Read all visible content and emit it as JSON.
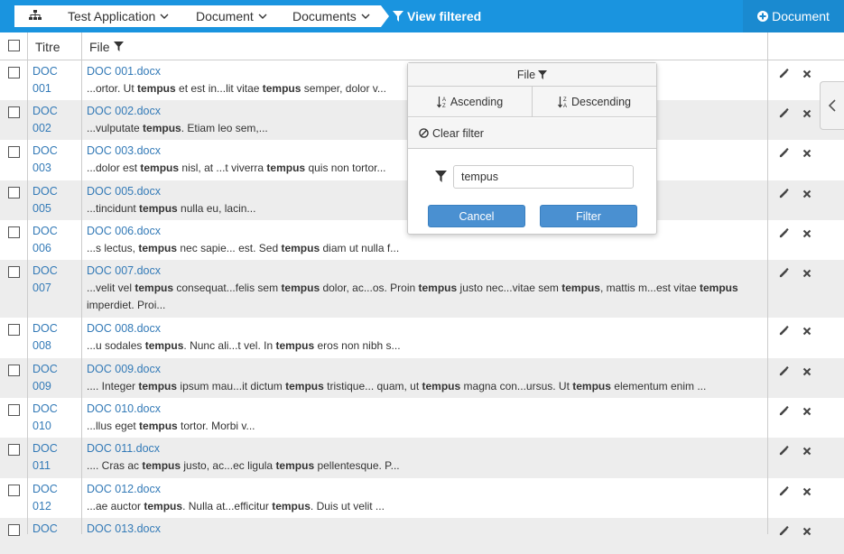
{
  "breadcrumb": {
    "home_icon": "sitemap-icon",
    "items": [
      {
        "label": "Test Application"
      },
      {
        "label": "Document"
      },
      {
        "label": "Documents"
      }
    ],
    "active_label": "View filtered"
  },
  "add_document_label": "Document",
  "table": {
    "col_titre": "Titre",
    "col_file": "File",
    "rows": [
      {
        "titre_a": "DOC",
        "titre_b": "001",
        "file": "DOC 001.docx",
        "snippet": [
          "...ortor. Ut ",
          "tempus",
          " et est in...lit vitae ",
          "tempus",
          " semper, dolor v..."
        ]
      },
      {
        "titre_a": "DOC",
        "titre_b": "002",
        "file": "DOC 002.docx",
        "snippet": [
          "...vulputate ",
          "tempus",
          ". Etiam leo sem,..."
        ]
      },
      {
        "titre_a": "DOC",
        "titre_b": "003",
        "file": "DOC 003.docx",
        "snippet": [
          "...dolor est ",
          "tempus",
          " nisl, at ...t viverra ",
          "tempus",
          " quis non tortor..."
        ]
      },
      {
        "titre_a": "DOC",
        "titre_b": "005",
        "file": "DOC 005.docx",
        "snippet": [
          "...tincidunt ",
          "tempus",
          " nulla eu, lacin..."
        ]
      },
      {
        "titre_a": "DOC",
        "titre_b": "006",
        "file": "DOC 006.docx",
        "snippet": [
          "...s lectus, ",
          "tempus",
          " nec sapie... est. Sed ",
          "tempus",
          " diam ut nulla f..."
        ]
      },
      {
        "titre_a": "DOC",
        "titre_b": "007",
        "file": "DOC 007.docx",
        "snippet": [
          "...velit vel ",
          "tempus",
          " consequat...felis sem ",
          "tempus",
          " dolor, ac...os. Proin ",
          "tempus",
          " justo nec...vitae sem ",
          "tempus",
          ", mattis m...est vitae ",
          "tempus",
          " imperdiet. Proi..."
        ]
      },
      {
        "titre_a": "DOC",
        "titre_b": "008",
        "file": "DOC 008.docx",
        "snippet": [
          "...u sodales ",
          "tempus",
          ". Nunc ali...t vel. In ",
          "tempus",
          " eros non nibh s..."
        ]
      },
      {
        "titre_a": "DOC",
        "titre_b": "009",
        "file": "DOC 009.docx",
        "snippet": [
          ".... Integer ",
          "tempus",
          " ipsum mau...it dictum ",
          "tempus",
          " tristique... quam, ut ",
          "tempus",
          " magna con...ursus. Ut ",
          "tempus",
          " elementum enim ..."
        ]
      },
      {
        "titre_a": "DOC",
        "titre_b": "010",
        "file": "DOC 010.docx",
        "snippet": [
          "...llus eget ",
          "tempus",
          " tortor. Morbi v..."
        ]
      },
      {
        "titre_a": "DOC",
        "titre_b": "011",
        "file": "DOC 011.docx",
        "snippet": [
          ".... Cras ac ",
          "tempus",
          " justo, ac...ec ligula ",
          "tempus",
          " pellentesque. P..."
        ]
      },
      {
        "titre_a": "DOC",
        "titre_b": "012",
        "file": "DOC 012.docx",
        "snippet": [
          "...ae auctor ",
          "tempus",
          ". Nulla at...efficitur ",
          "tempus",
          ". Duis ut velit ..."
        ]
      },
      {
        "titre_a": "DOC",
        "titre_b": "",
        "file": "DOC 013.docx",
        "snippet": [
          ""
        ]
      }
    ]
  },
  "filter_popup": {
    "title": "File",
    "ascending": "Ascending",
    "descending": "Descending",
    "clear": "Clear filter",
    "value": "tempus",
    "cancel": "Cancel",
    "apply": "Filter"
  },
  "colors": {
    "header_blue": "#1a94df",
    "link_blue": "#337ab7",
    "button_blue": "#4a90d1",
    "row_alt": "#ededed"
  }
}
